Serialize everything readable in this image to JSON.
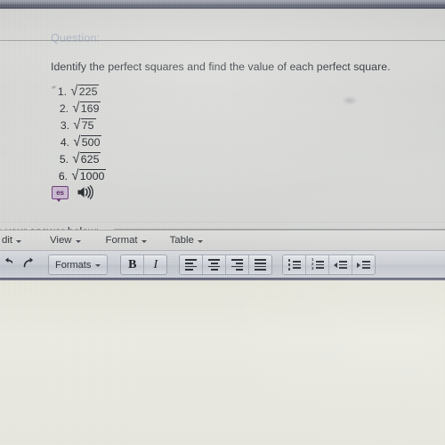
{
  "header": {
    "question_label": "Question:"
  },
  "question": {
    "prompt": "Identify the perfect squares and find the value of each perfect square.",
    "items": [
      {
        "number": "1.",
        "radicand": "225"
      },
      {
        "number": "2.",
        "radicand": "169"
      },
      {
        "number": "3.",
        "radicand": "75"
      },
      {
        "number": "4.",
        "radicand": "500"
      },
      {
        "number": "5.",
        "radicand": "625"
      },
      {
        "number": "6.",
        "radicand": "1000"
      }
    ],
    "radical_sign": "√",
    "language_badge": "es",
    "speaker_icon": "speaker-icon"
  },
  "answer_section": {
    "prompt": "e your answer below:"
  },
  "editor": {
    "menus": [
      {
        "label": "dit",
        "name": "menu-edit"
      },
      {
        "label": "View",
        "name": "menu-view"
      },
      {
        "label": "Format",
        "name": "menu-format"
      },
      {
        "label": "Table",
        "name": "menu-table"
      }
    ],
    "toolbar": {
      "undo_icon": "undo-icon",
      "redo_icon": "redo-icon",
      "formats_label": "Formats",
      "bold_label": "B",
      "italic_label": "I",
      "align_left": "align-left-icon",
      "align_center": "align-center-icon",
      "align_right": "align-right-icon",
      "align_justify": "align-justify-icon",
      "bullet_list": "bulleted-list-icon",
      "numbered_list": "numbered-list-icon",
      "outdent": "outdent-icon",
      "indent": "indent-icon"
    }
  },
  "colors": {
    "page_bg": "#d5d6d4",
    "desk_bg": "#e8e8e0",
    "text": "#23262c",
    "question_label": "#a9b2c2",
    "badge_purple": "#6e3f7a",
    "top_band": "#5d6173"
  }
}
